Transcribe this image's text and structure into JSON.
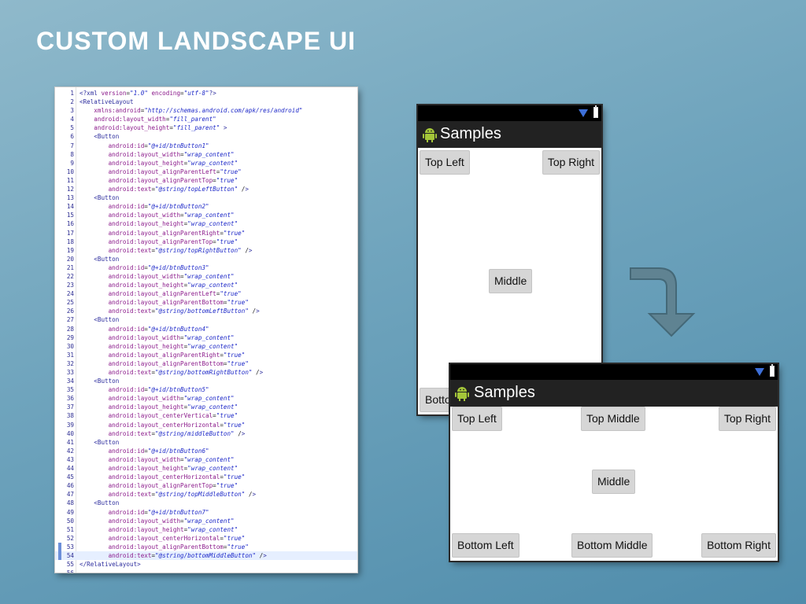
{
  "slide": {
    "title": "CUSTOM LANDSCAPE UI"
  },
  "code": {
    "highlighted_line": 54,
    "lines": [
      {
        "n": "1",
        "text": "<?xml version=\"1.0\" encoding=\"utf-8\"?>"
      },
      {
        "n": "2",
        "text": "<RelativeLayout"
      },
      {
        "n": "3",
        "text": "    xmlns:android=\"http://schemas.android.com/apk/res/android\""
      },
      {
        "n": "4",
        "text": "    android:layout_width=\"fill_parent\""
      },
      {
        "n": "5",
        "text": "    android:layout_height=\"fill_parent\" >"
      },
      {
        "n": "6",
        "text": "    <Button"
      },
      {
        "n": "7",
        "text": "        android:id=\"@+id/btnButton1\""
      },
      {
        "n": "8",
        "text": "        android:layout_width=\"wrap_content\""
      },
      {
        "n": "9",
        "text": "        android:layout_height=\"wrap_content\""
      },
      {
        "n": "10",
        "text": "        android:layout_alignParentLeft=\"true\""
      },
      {
        "n": "11",
        "text": "        android:layout_alignParentTop=\"true\""
      },
      {
        "n": "12",
        "text": "        android:text=\"@string/topLeftButton\" />"
      },
      {
        "n": "13",
        "text": "    <Button"
      },
      {
        "n": "14",
        "text": "        android:id=\"@+id/btnButton2\""
      },
      {
        "n": "15",
        "text": "        android:layout_width=\"wrap_content\""
      },
      {
        "n": "16",
        "text": "        android:layout_height=\"wrap_content\""
      },
      {
        "n": "17",
        "text": "        android:layout_alignParentRight=\"true\""
      },
      {
        "n": "18",
        "text": "        android:layout_alignParentTop=\"true\""
      },
      {
        "n": "19",
        "text": "        android:text=\"@string/topRightButton\" />"
      },
      {
        "n": "20",
        "text": "    <Button"
      },
      {
        "n": "21",
        "text": "        android:id=\"@+id/btnButton3\""
      },
      {
        "n": "22",
        "text": "        android:layout_width=\"wrap_content\""
      },
      {
        "n": "23",
        "text": "        android:layout_height=\"wrap_content\""
      },
      {
        "n": "24",
        "text": "        android:layout_alignParentLeft=\"true\""
      },
      {
        "n": "25",
        "text": "        android:layout_alignParentBottom=\"true\""
      },
      {
        "n": "26",
        "text": "        android:text=\"@string/bottomLeftButton\" />"
      },
      {
        "n": "27",
        "text": "    <Button"
      },
      {
        "n": "28",
        "text": "        android:id=\"@+id/btnButton4\""
      },
      {
        "n": "29",
        "text": "        android:layout_width=\"wrap_content\""
      },
      {
        "n": "30",
        "text": "        android:layout_height=\"wrap_content\""
      },
      {
        "n": "31",
        "text": "        android:layout_alignParentRight=\"true\""
      },
      {
        "n": "32",
        "text": "        android:layout_alignParentBottom=\"true\""
      },
      {
        "n": "33",
        "text": "        android:text=\"@string/bottomRightButton\" />"
      },
      {
        "n": "34",
        "text": "    <Button"
      },
      {
        "n": "35",
        "text": "        android:id=\"@+id/btnButton5\""
      },
      {
        "n": "36",
        "text": "        android:layout_width=\"wrap_content\""
      },
      {
        "n": "37",
        "text": "        android:layout_height=\"wrap_content\""
      },
      {
        "n": "38",
        "text": "        android:layout_centerVertical=\"true\""
      },
      {
        "n": "39",
        "text": "        android:layout_centerHorizontal=\"true\""
      },
      {
        "n": "40",
        "text": "        android:text=\"@string/middleButton\" />"
      },
      {
        "n": "41",
        "text": "    <Button"
      },
      {
        "n": "42",
        "text": "        android:id=\"@+id/btnButton6\""
      },
      {
        "n": "43",
        "text": "        android:layout_width=\"wrap_content\""
      },
      {
        "n": "44",
        "text": "        android:layout_height=\"wrap_content\""
      },
      {
        "n": "45",
        "text": "        android:layout_centerHorizontal=\"true\""
      },
      {
        "n": "46",
        "text": "        android:layout_alignParentTop=\"true\""
      },
      {
        "n": "47",
        "text": "        android:text=\"@string/topMiddleButton\" />"
      },
      {
        "n": "48",
        "text": "    <Button"
      },
      {
        "n": "49",
        "text": "        android:id=\"@+id/btnButton7\""
      },
      {
        "n": "50",
        "text": "        android:layout_width=\"wrap_content\""
      },
      {
        "n": "51",
        "text": "        android:layout_height=\"wrap_content\""
      },
      {
        "n": "52",
        "text": "        android:layout_centerHorizontal=\"true\""
      },
      {
        "n": "53",
        "text": "        android:layout_alignParentBottom=\"true\""
      },
      {
        "n": "54",
        "text": "        android:text=\"@string/bottomMiddleButton\" />"
      },
      {
        "n": "55",
        "text": "</RelativeLayout>"
      },
      {
        "n": "56",
        "text": ""
      }
    ]
  },
  "portrait": {
    "app_title": "Samples",
    "buttons": {
      "top_left": "Top Left",
      "top_right": "Top Right",
      "middle": "Middle",
      "bottom_left": "Botto"
    }
  },
  "landscape": {
    "app_title": "Samples",
    "buttons": {
      "top_left": "Top Left",
      "top_middle": "Top Middle",
      "top_right": "Top Right",
      "middle": "Middle",
      "bottom_left": "Bottom Left",
      "bottom_middle": "Bottom Middle",
      "bottom_right": "Bottom Right"
    }
  },
  "icons": {
    "wifi": "wifi-signal-icon",
    "battery": "battery-icon",
    "app": "android-app-icon",
    "arrow": "curved-down-arrow-icon"
  },
  "colors": {
    "background": "#6fa4bd",
    "title_text": "#ffffff",
    "action_bar": "#222222",
    "status_bar": "#000000",
    "button": "#d6d6d6",
    "wifi_icon": "#3d6fd8",
    "arrow_fill": "#5f7f8c"
  }
}
